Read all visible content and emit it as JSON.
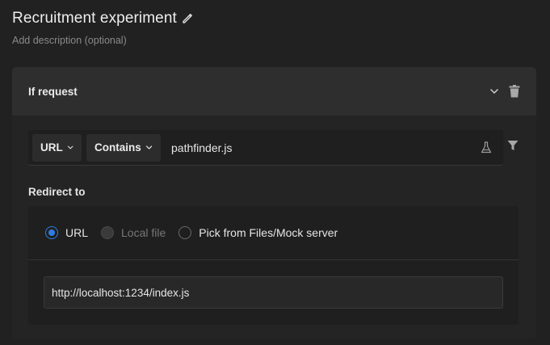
{
  "rule": {
    "title": "Recruitment experiment",
    "description_placeholder": "Add description (optional)"
  },
  "card": {
    "header_title": "If request",
    "icons": {
      "collapse": "chevron-down-icon",
      "delete": "trash-icon"
    }
  },
  "condition": {
    "source_type": "URL",
    "operator": "Contains",
    "value": "pathfinder.js",
    "icons": {
      "test": "flask-icon",
      "filter": "filter-icon"
    }
  },
  "redirect": {
    "label": "Redirect to",
    "options": [
      {
        "label": "URL",
        "state": "selected"
      },
      {
        "label": "Local file",
        "state": "disabled"
      },
      {
        "label": "Pick from Files/Mock server",
        "state": "unselected"
      }
    ],
    "destination_url": "http://localhost:1234/index.js"
  },
  "colors": {
    "background": "#212121",
    "card": "#292929",
    "accent": "#2f7de0"
  }
}
